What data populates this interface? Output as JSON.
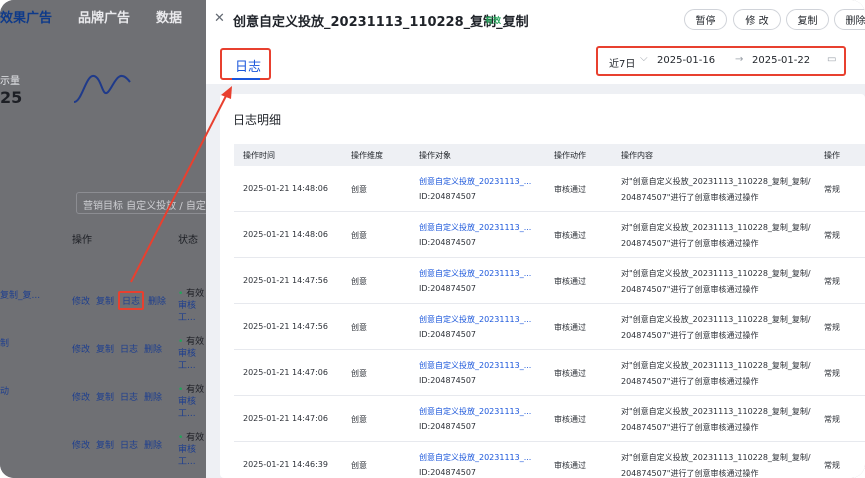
{
  "background": {
    "nav": [
      "效果广告",
      "品牌广告",
      "数据",
      "工"
    ],
    "metric_label": "示量",
    "metric_value": "25",
    "filter_text": "营销目标  自定义投放 / 自定",
    "col_actions": "操作",
    "col_status": "状态",
    "rows": [
      {
        "name": "复制_复...",
        "actions": [
          "修改",
          "复制",
          "日志",
          "删除"
        ],
        "status": "有效",
        "sub": "审核工..."
      },
      {
        "name": "制",
        "actions": [
          "修改",
          "复制",
          "日志",
          "删除"
        ],
        "status": "有效",
        "sub": "审核工..."
      },
      {
        "name": "动",
        "actions": [
          "修改",
          "复制",
          "日志",
          "删除"
        ],
        "status": "有效",
        "sub": "审核工..."
      },
      {
        "name": "",
        "actions": [
          "修改",
          "复制",
          "日志",
          "删除"
        ],
        "status": "有效",
        "sub": "审核工..."
      }
    ]
  },
  "drawer": {
    "close_icon": "close-icon",
    "title": "创意自定义投放_20231113_110228_复制_复制",
    "status": "有效",
    "buttons": [
      "暂停",
      "修 改",
      "复制",
      "删除"
    ],
    "tab": "日志",
    "date_range_label": "近7日",
    "date_start": "2025-01-16",
    "date_end": "2025-01-22",
    "panel_title": "日志明细",
    "columns": [
      "操作时间",
      "操作维度",
      "操作对象",
      "操作动作",
      "操作内容",
      "操作"
    ],
    "rows": [
      {
        "time": "2025-01-21 14:48:06",
        "dim": "创意",
        "obj": "创意自定义投放_20231113_...",
        "id": "ID:204874507",
        "action": "审核通过",
        "c1": "对\"创意自定义投放_20231113_110228_复制_复制/",
        "c2": "204874507\"进行了创意审核通过操作",
        "type": "常规"
      },
      {
        "time": "2025-01-21 14:48:06",
        "dim": "创意",
        "obj": "创意自定义投放_20231113_...",
        "id": "ID:204874507",
        "action": "审核通过",
        "c1": "对\"创意自定义投放_20231113_110228_复制_复制/",
        "c2": "204874507\"进行了创意审核通过操作",
        "type": "常规"
      },
      {
        "time": "2025-01-21 14:47:56",
        "dim": "创意",
        "obj": "创意自定义投放_20231113_...",
        "id": "ID:204874507",
        "action": "审核通过",
        "c1": "对\"创意自定义投放_20231113_110228_复制_复制/",
        "c2": "204874507\"进行了创意审核通过操作",
        "type": "常规"
      },
      {
        "time": "2025-01-21 14:47:56",
        "dim": "创意",
        "obj": "创意自定义投放_20231113_...",
        "id": "ID:204874507",
        "action": "审核通过",
        "c1": "对\"创意自定义投放_20231113_110228_复制_复制/",
        "c2": "204874507\"进行了创意审核通过操作",
        "type": "常规"
      },
      {
        "time": "2025-01-21 14:47:06",
        "dim": "创意",
        "obj": "创意自定义投放_20231113_...",
        "id": "ID:204874507",
        "action": "审核通过",
        "c1": "对\"创意自定义投放_20231113_110228_复制_复制/",
        "c2": "204874507\"进行了创意审核通过操作",
        "type": "常规"
      },
      {
        "time": "2025-01-21 14:47:06",
        "dim": "创意",
        "obj": "创意自定义投放_20231113_...",
        "id": "ID:204874507",
        "action": "审核通过",
        "c1": "对\"创意自定义投放_20231113_110228_复制_复制/",
        "c2": "204874507\"进行了创意审核通过操作",
        "type": "常规"
      },
      {
        "time": "2025-01-21 14:46:39",
        "dim": "创意",
        "obj": "创意自定义投放_20231113_...",
        "id": "ID:204874507",
        "action": "审核通过",
        "c1": "对\"创意自定义投放_20231113_110228_复制_复制/",
        "c2": "204874507\"进行了创意审核通过操作",
        "type": "常规"
      }
    ]
  },
  "colors": {
    "accent": "#1a56db",
    "annotation": "#e8402f",
    "success": "#23a55a"
  }
}
